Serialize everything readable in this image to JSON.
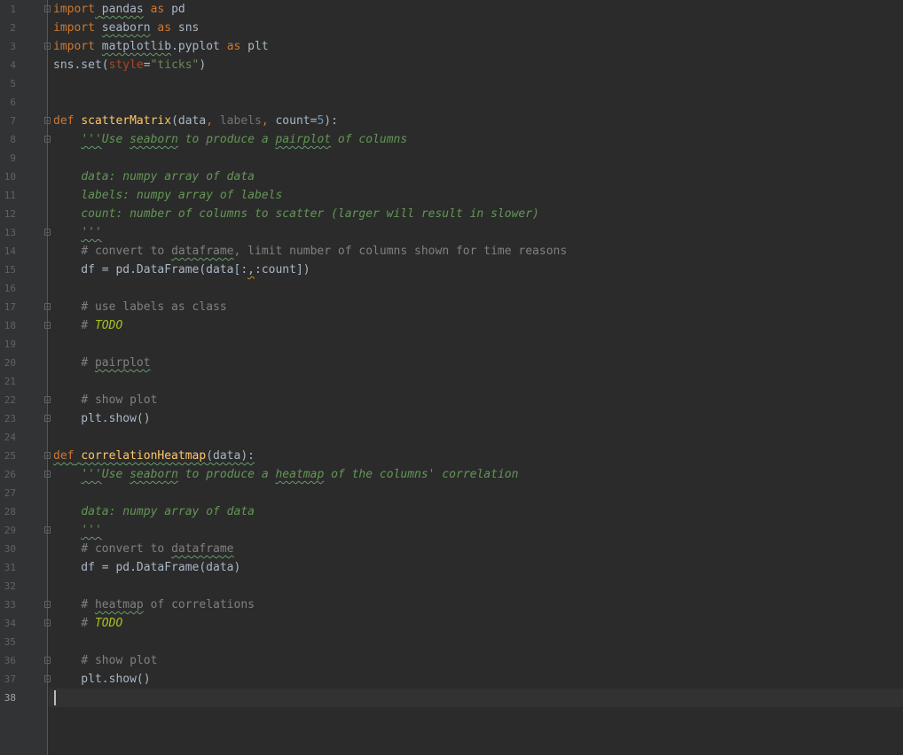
{
  "editor": {
    "current_line": 38,
    "lines": [
      {
        "n": "1",
        "fold": true,
        "tokens": [
          [
            "kw",
            "import"
          ],
          [
            "",
            ""
          ],
          [
            "typo",
            " "
          ],
          [
            "typo",
            "pandas"
          ],
          [
            "",
            " "
          ],
          [
            "kw",
            "as"
          ],
          [
            "",
            " pd"
          ]
        ]
      },
      {
        "n": "2",
        "fold": false,
        "tokens": [
          [
            "kw",
            "import"
          ],
          [
            "",
            " "
          ],
          [
            "typo",
            "seaborn"
          ],
          [
            "",
            " "
          ],
          [
            "kw",
            "as"
          ],
          [
            "",
            " sns"
          ]
        ]
      },
      {
        "n": "3",
        "fold": true,
        "tokens": [
          [
            "kw",
            "import"
          ],
          [
            "",
            " "
          ],
          [
            "typo",
            "matplotlib"
          ],
          [
            ".pyplot "
          ],
          [
            "kw",
            "as"
          ],
          [
            "",
            " plt"
          ]
        ]
      },
      {
        "n": "4",
        "fold": false,
        "tokens": [
          [
            "",
            "sns.set("
          ],
          [
            "kwarg",
            "style"
          ],
          [
            "",
            "="
          ],
          [
            "str",
            "\"ticks\""
          ],
          [
            "",
            ")"
          ]
        ]
      },
      {
        "n": "5",
        "fold": false,
        "tokens": []
      },
      {
        "n": "6",
        "fold": false,
        "tokens": []
      },
      {
        "n": "7",
        "fold": true,
        "tokens": [
          [
            "kw",
            "def"
          ],
          [
            "",
            " "
          ],
          [
            "fn",
            "scatterMatrix"
          ],
          [
            "",
            "(data"
          ],
          [
            "kw",
            ","
          ],
          [
            "",
            " "
          ],
          [
            "unused",
            "labels"
          ],
          [
            "kw",
            ","
          ],
          [
            "",
            " count="
          ],
          [
            "num",
            "5"
          ],
          [
            "",
            "):"
          ]
        ]
      },
      {
        "n": "8",
        "fold": true,
        "tokens": [
          [
            "",
            "    "
          ],
          [
            "doc-typo",
            "'''"
          ],
          [
            "doc",
            "Use "
          ],
          [
            "doc-typo",
            "seaborn"
          ],
          [
            "doc",
            " to produce a "
          ],
          [
            "doc-typo",
            "pairplot"
          ],
          [
            "doc",
            " of columns"
          ]
        ]
      },
      {
        "n": "9",
        "fold": false,
        "tokens": []
      },
      {
        "n": "10",
        "fold": false,
        "tokens": [
          [
            "",
            "    "
          ],
          [
            "doc",
            "data: numpy array of data"
          ]
        ]
      },
      {
        "n": "11",
        "fold": false,
        "tokens": [
          [
            "",
            "    "
          ],
          [
            "doc",
            "labels: numpy array of labels"
          ]
        ]
      },
      {
        "n": "12",
        "fold": false,
        "tokens": [
          [
            "",
            "    "
          ],
          [
            "doc",
            "count: number of columns to scatter (larger will result in slower)"
          ]
        ]
      },
      {
        "n": "13",
        "fold": true,
        "tokens": [
          [
            "",
            "    "
          ],
          [
            "doc-typo",
            "'''"
          ]
        ]
      },
      {
        "n": "14",
        "fold": false,
        "tokens": [
          [
            "",
            "    "
          ],
          [
            "cm",
            "# convert to "
          ],
          [
            "cm-typo",
            "dataframe"
          ],
          [
            "cm",
            ", limit number of columns shown for time reasons"
          ]
        ]
      },
      {
        "n": "15",
        "fold": false,
        "tokens": [
          [
            "",
            "    df = pd.DataFrame(data[:"
          ],
          [
            "warn",
            ","
          ],
          [
            "",
            ":count])"
          ]
        ]
      },
      {
        "n": "16",
        "fold": false,
        "tokens": []
      },
      {
        "n": "17",
        "fold": true,
        "tokens": [
          [
            "",
            "    "
          ],
          [
            "cm",
            "# use labels as class"
          ]
        ]
      },
      {
        "n": "18",
        "fold": true,
        "tokens": [
          [
            "",
            "    "
          ],
          [
            "cm",
            "# "
          ],
          [
            "todo",
            "TODO"
          ]
        ]
      },
      {
        "n": "19",
        "fold": false,
        "tokens": []
      },
      {
        "n": "20",
        "fold": false,
        "tokens": [
          [
            "",
            "    "
          ],
          [
            "cm",
            "# "
          ],
          [
            "cm-typo",
            "pairplot"
          ]
        ]
      },
      {
        "n": "21",
        "fold": false,
        "tokens": []
      },
      {
        "n": "22",
        "fold": true,
        "tokens": [
          [
            "",
            "    "
          ],
          [
            "cm",
            "# show plot"
          ]
        ]
      },
      {
        "n": "23",
        "fold": true,
        "tokens": [
          [
            "",
            "    plt.show()"
          ]
        ]
      },
      {
        "n": "24",
        "fold": false,
        "tokens": []
      },
      {
        "n": "25",
        "fold": true,
        "tokens": [
          [
            "kw-typo",
            "def"
          ],
          [
            "typo",
            " "
          ],
          [
            "fn-typo",
            "correlationHeatmap"
          ],
          [
            "typo",
            "(data):"
          ]
        ]
      },
      {
        "n": "26",
        "fold": true,
        "tokens": [
          [
            "",
            "    "
          ],
          [
            "doc-typo",
            "'''"
          ],
          [
            "doc",
            "Use "
          ],
          [
            "doc-typo",
            "seaborn"
          ],
          [
            "doc",
            " to produce a "
          ],
          [
            "doc-typo",
            "heatmap"
          ],
          [
            "doc",
            " of the columns' correlation"
          ]
        ]
      },
      {
        "n": "27",
        "fold": false,
        "tokens": []
      },
      {
        "n": "28",
        "fold": false,
        "tokens": [
          [
            "",
            "    "
          ],
          [
            "doc",
            "data: numpy array of data"
          ]
        ]
      },
      {
        "n": "29",
        "fold": true,
        "tokens": [
          [
            "",
            "    "
          ],
          [
            "doc-typo",
            "'''"
          ]
        ]
      },
      {
        "n": "30",
        "fold": false,
        "tokens": [
          [
            "",
            "    "
          ],
          [
            "cm",
            "# convert to "
          ],
          [
            "cm-typo",
            "dataframe"
          ]
        ]
      },
      {
        "n": "31",
        "fold": false,
        "tokens": [
          [
            "",
            "    df = pd.DataFrame(data)"
          ]
        ]
      },
      {
        "n": "32",
        "fold": false,
        "tokens": []
      },
      {
        "n": "33",
        "fold": true,
        "tokens": [
          [
            "",
            "    "
          ],
          [
            "cm",
            "# "
          ],
          [
            "cm-typo",
            "heatmap"
          ],
          [
            "cm",
            " of correlations"
          ]
        ]
      },
      {
        "n": "34",
        "fold": true,
        "tokens": [
          [
            "",
            "    "
          ],
          [
            "cm",
            "# "
          ],
          [
            "todo",
            "TODO"
          ]
        ]
      },
      {
        "n": "35",
        "fold": false,
        "tokens": []
      },
      {
        "n": "36",
        "fold": true,
        "tokens": [
          [
            "",
            "    "
          ],
          [
            "cm",
            "# show plot"
          ]
        ]
      },
      {
        "n": "37",
        "fold": true,
        "tokens": [
          [
            "",
            "    plt.show()"
          ]
        ]
      },
      {
        "n": "38",
        "fold": false,
        "tokens": []
      }
    ]
  }
}
